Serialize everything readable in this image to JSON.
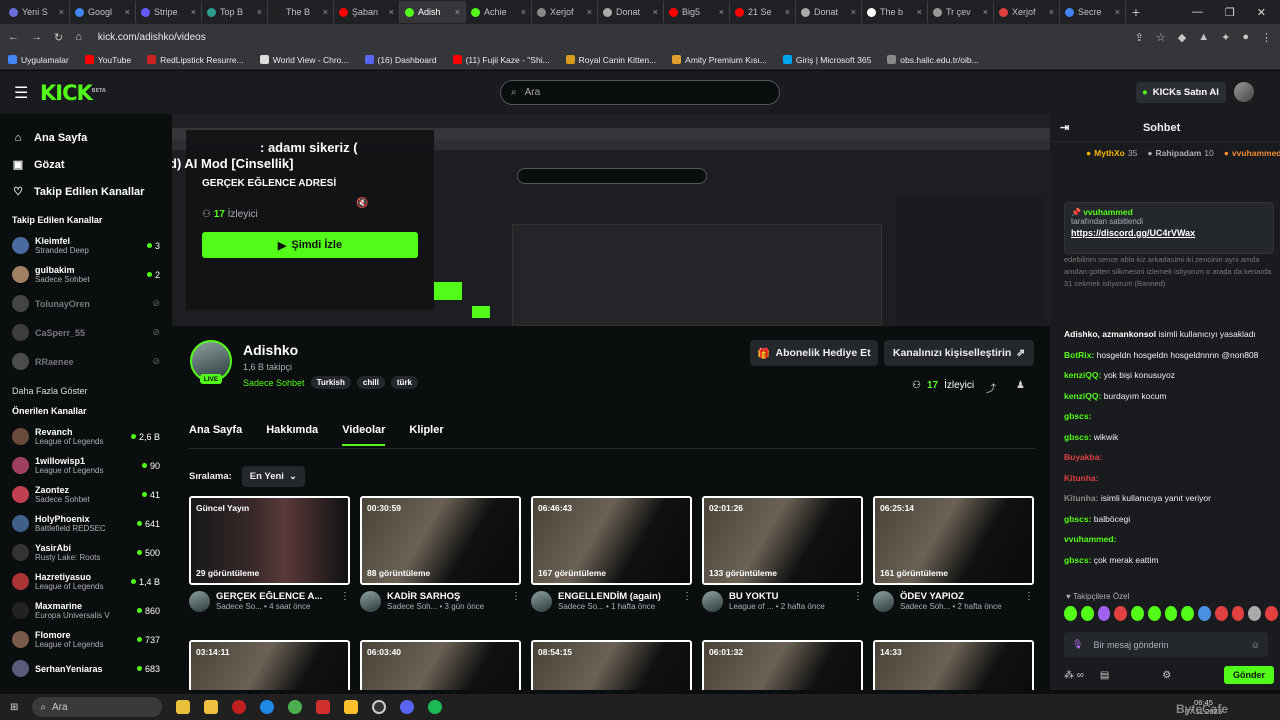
{
  "browser": {
    "tabs": [
      {
        "label": "Yeni S",
        "color": "#6b6bdb"
      },
      {
        "label": "Googl",
        "color": "#4285f4"
      },
      {
        "label": "Stripe",
        "color": "#635bff"
      },
      {
        "label": "Top B",
        "color": "#2a9d8f"
      },
      {
        "label": "The B",
        "color": "#222222"
      },
      {
        "label": "Şaban",
        "color": "#ff0000"
      },
      {
        "label": "Adish",
        "color": "#53fc18",
        "active": true
      },
      {
        "label": "Achie",
        "color": "#53fc18"
      },
      {
        "label": "Xerjof",
        "color": "#888888"
      },
      {
        "label": "Donat",
        "color": "#aaaaaa"
      },
      {
        "label": "Big5",
        "color": "#ff0000"
      },
      {
        "label": "21 Se",
        "color": "#ff0000"
      },
      {
        "label": "Donat",
        "color": "#aaaaaa"
      },
      {
        "label": "The b",
        "color": "#ffffff"
      },
      {
        "label": "Tr çev",
        "color": "#999999"
      },
      {
        "label": "Xerjof",
        "color": "#e04040"
      },
      {
        "label": "Secre",
        "color": "#4285f4"
      }
    ],
    "url": "kick.com/adishko/videos",
    "bookmarks": [
      {
        "label": "Uygulamalar",
        "color": "#4285f4"
      },
      {
        "label": "YouTube",
        "color": "#ff0000"
      },
      {
        "label": "RedLipstick Resurre...",
        "color": "#cc2222"
      },
      {
        "label": "World View - Chro...",
        "color": "#dddddd"
      },
      {
        "label": "(16) Dashboard",
        "color": "#5865f2"
      },
      {
        "label": "(11) Fujii Kaze - \"Shi...",
        "color": "#ff0000"
      },
      {
        "label": "Royal Canin Kitten...",
        "color": "#d89a1a"
      },
      {
        "label": "Amity Premium Kısı...",
        "color": "#e0a030"
      },
      {
        "label": "Giriş | Microsoft 365",
        "color": "#00a4ef"
      },
      {
        "label": "obs.halic.edu.tr/oib...",
        "color": "#888888"
      }
    ]
  },
  "header": {
    "logo": "KICK",
    "logo_sup": "BETA",
    "search_placeholder": "Ara",
    "buy_ai": "KICKs Satın Al"
  },
  "sidebar": {
    "nav": [
      {
        "label": "Ana Sayfa",
        "icon": "home-icon",
        "glyph": "⌂"
      },
      {
        "label": "Gözat",
        "icon": "browse-icon",
        "glyph": "▣"
      },
      {
        "label": "Takip Edilen Kanallar",
        "icon": "heart-icon",
        "glyph": "♡"
      }
    ],
    "followed_title": "Takip Edilen Kanallar",
    "followed": [
      {
        "name": "Kleimfel",
        "sub": "Stranded Deep",
        "count": "3",
        "live": true,
        "avatar": "#4a6aa0"
      },
      {
        "name": "gulbakim",
        "sub": "Sadece Sohbet",
        "count": "2",
        "live": true,
        "avatar": "#a08060"
      },
      {
        "name": "TolunayOren",
        "sub": "",
        "count": "",
        "live": false,
        "avatar": "#888888"
      },
      {
        "name": "CaSperr_55",
        "sub": "",
        "count": "",
        "live": false,
        "avatar": "#777777"
      },
      {
        "name": "RRaenee",
        "sub": "",
        "count": "",
        "live": false,
        "avatar": "#999999"
      }
    ],
    "more_label": "Daha Fazla Göster",
    "suggested_title": "Önerilen Kanallar",
    "suggested": [
      {
        "name": "Revanch",
        "sub": "League of Legends",
        "count": "2,6 B",
        "avatar": "#6a4a3a"
      },
      {
        "name": "1willowisp1",
        "sub": "League of Legends",
        "count": "90",
        "avatar": "#a04060"
      },
      {
        "name": "Zaontez",
        "sub": "Sadece Sohbet",
        "count": "41",
        "avatar": "#c04050"
      },
      {
        "name": "HolyPhoenix",
        "sub": "Battlefield REDSEC",
        "count": "641",
        "avatar": "#40608a"
      },
      {
        "name": "YasirAbi",
        "sub": "Rusty Lake: Roots",
        "count": "500",
        "avatar": "#333333"
      },
      {
        "name": "Hazretiyasuo",
        "sub": "League of Legends",
        "count": "1,4 B",
        "avatar": "#aa3333"
      },
      {
        "name": "Maxmarine",
        "sub": "Europa Universalis V",
        "count": "860",
        "avatar": "#222222"
      },
      {
        "name": "Flomore",
        "sub": "League of Legends",
        "count": "737",
        "avatar": "#7a5a4a"
      },
      {
        "name": "SerhanYeniaras",
        "sub": "",
        "count": "683",
        "avatar": "#5a5a7a"
      }
    ]
  },
  "hero": {
    "title_top": ": adamı sikeriz (",
    "title_bottom": "Deleted) AI Mod [Cinsellik]",
    "subtitle": "GERÇEK EĞLENCE ADRESİ",
    "viewers_count": "17",
    "viewers_label": "İzleyici",
    "watch_button": "Şimdi İzle"
  },
  "profile": {
    "name": "Adishko",
    "followers": "1,6 B takipçi",
    "live_badge": "LIVE",
    "category": "Sadece Sohbet",
    "tags": [
      "Turkish",
      "chill",
      "türk"
    ],
    "gift_button": "Abonelik Hediye Et",
    "customize_button": "Kanalınızı kişiselleştirin",
    "viewers_count": "17",
    "viewers_label": "İzleyici"
  },
  "tabs": [
    "Ana Sayfa",
    "Hakkımda",
    "Videolar",
    "Klipler"
  ],
  "active_tab": "Videolar",
  "sort": {
    "label": "Sıralama:",
    "value": "En Yeni"
  },
  "videos": [
    {
      "duration": "Güncel Yayın",
      "views": "29 görüntüleme",
      "title": "GERÇEK EĞLENCE A...",
      "category": "Sadece So...",
      "age": "4 saat önce"
    },
    {
      "duration": "00:30:59",
      "views": "88 görüntüleme",
      "title": "KADİR SARHOŞ",
      "category": "Sadece Soh...",
      "age": "3 gün önce"
    },
    {
      "duration": "06:46:43",
      "views": "167 görüntüleme",
      "title": "ENGELLENDİM (again)",
      "category": "Sadece So...",
      "age": "1 hafta önce"
    },
    {
      "duration": "02:01:26",
      "views": "133 görüntüleme",
      "title": "BU YOKTU",
      "category": "League of ...",
      "age": "2 hafta önce"
    },
    {
      "duration": "06:25:14",
      "views": "161 görüntüleme",
      "title": "ÖDEV YAPIOZ",
      "category": "Sadece Soh...",
      "age": "2 hafta önce"
    }
  ],
  "videos_row2": [
    "03:14:11",
    "06:03:40",
    "08:54:15",
    "06:01:32",
    "14:33"
  ],
  "chat": {
    "title": "Sohbet",
    "leaders": [
      {
        "name": "MythXo",
        "value": "35",
        "color": "#f2b400"
      },
      {
        "name": "Rahipadam",
        "value": "10",
        "color": "#adadb8"
      },
      {
        "name": "vvuhammed",
        "value": "1",
        "color": "#f08a30"
      }
    ],
    "pinned_user": "vvuhammed",
    "pinned_note": "tarafından sabitlendi",
    "pinned_link": "https://discord.gg/UC4rVWax",
    "old_text": "edebilirim sence abla kiz arkadasimi iki zencinin ayni amda amdan gotten silkmesini izlemek istiyorum o arada da kenarda 31 cekmek istiyorum (Banned)",
    "messages": [
      {
        "user": "Adishko, azmankonsol",
        "text": "isimli kullanıcıyı yasakladı",
        "color": "#ffffff"
      },
      {
        "user": "BotRix:",
        "text": "hosgeldn hosgeldn hosgeldnnnn @non808",
        "color": "#53fc18"
      },
      {
        "user": "kenziQQ:",
        "text": "yok bişi konusuyoz",
        "color": "#53fc18"
      },
      {
        "user": "kenziQQ:",
        "text": "burdayım kocum",
        "color": "#53fc18"
      },
      {
        "user": "gbscs:",
        "text": "",
        "color": "#53fc18"
      },
      {
        "user": "gbscs:",
        "text": "wikwik",
        "color": "#53fc18"
      },
      {
        "user": "Buyakba:",
        "text": "",
        "color": "#e04040"
      },
      {
        "user": "Kitunha:",
        "text": "",
        "color": "#e04040"
      },
      {
        "user": "Kitunha:",
        "text": "isimli kullanıcıya yanıt veriyor",
        "color": "#888888"
      },
      {
        "user": "gbscs:",
        "text": "balböcegi",
        "color": "#53fc18"
      },
      {
        "user": "vvuhammed:",
        "text": "",
        "color": "#53fc18"
      },
      {
        "user": "gbscs:",
        "text": "çok merak eattim",
        "color": "#53fc18"
      }
    ],
    "follow_only": "Takipçilere Özel",
    "input_placeholder": "Bir mesaj gönderin",
    "send_button": "Gönder"
  },
  "taskbar": {
    "search": "Ara",
    "time": "06:45",
    "date": "07.11.2025"
  },
  "watermark": "ByteCafe"
}
